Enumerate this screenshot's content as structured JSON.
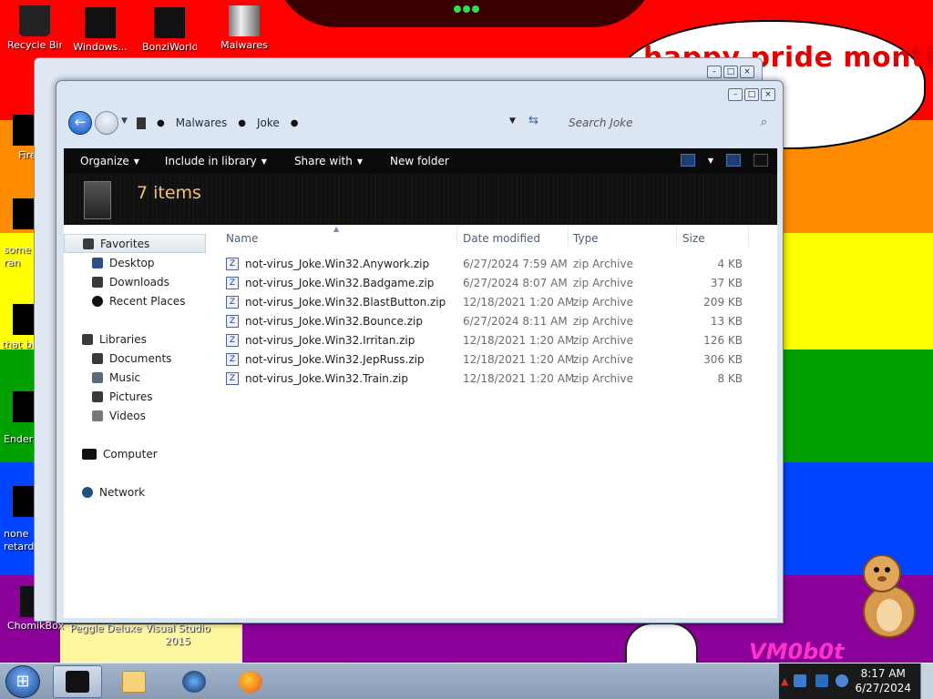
{
  "desktop": {
    "bubble_text": "happy pride month",
    "vm_tag": "VM0b0t",
    "icons": [
      {
        "label": "Recycle Bin"
      },
      {
        "label": "Windows..."
      },
      {
        "label": "BonziWorld"
      },
      {
        "label": "Malwares"
      },
      {
        "label": "Firefox"
      },
      {
        "label": "some ran"
      },
      {
        "label": "that bu"
      },
      {
        "label": "Ender"
      },
      {
        "label": "none retard"
      },
      {
        "label": "ChomikBox"
      },
      {
        "label": "Peggle Deluxe"
      },
      {
        "label": "Visual Studio 2015"
      }
    ]
  },
  "window": {
    "controls": {
      "minimize": "–",
      "maximize": "□",
      "close": "×"
    },
    "breadcrumb": [
      "Malwares",
      "Joke"
    ],
    "search_placeholder": "Search Joke",
    "toolbar": {
      "organize": "Organize",
      "include": "Include in library",
      "share": "Share with",
      "new_folder": "New folder"
    },
    "item_count": "7 items",
    "nav": {
      "favorites": "Favorites",
      "desktop": "Desktop",
      "downloads": "Downloads",
      "recent": "Recent Places",
      "libraries": "Libraries",
      "documents": "Documents",
      "music": "Music",
      "pictures": "Pictures",
      "videos": "Videos",
      "computer": "Computer",
      "network": "Network"
    },
    "columns": {
      "name": "Name",
      "date": "Date modified",
      "type": "Type",
      "size": "Size"
    },
    "files": [
      {
        "name": "not-virus_Joke.Win32.Anywork.zip",
        "date": "6/27/2024 7:59 AM",
        "type": "zip Archive",
        "size": "4 KB"
      },
      {
        "name": "not-virus_Joke.Win32.Badgame.zip",
        "date": "6/27/2024 8:07 AM",
        "type": "zip Archive",
        "size": "37 KB"
      },
      {
        "name": "not-virus_Joke.Win32.BlastButton.zip",
        "date": "12/18/2021 1:20 AM",
        "type": "zip Archive",
        "size": "209 KB"
      },
      {
        "name": "not-virus_Joke.Win32.Bounce.zip",
        "date": "6/27/2024 8:11 AM",
        "type": "zip Archive",
        "size": "13 KB"
      },
      {
        "name": "not-virus_Joke.Win32.Irritan.zip",
        "date": "12/18/2021 1:20 AM",
        "type": "zip Archive",
        "size": "126 KB"
      },
      {
        "name": "not-virus_Joke.Win32.JepRuss.zip",
        "date": "12/18/2021 1:20 AM",
        "type": "zip Archive",
        "size": "306 KB"
      },
      {
        "name": "not-virus_Joke.Win32.Train.zip",
        "date": "12/18/2021 1:20 AM",
        "type": "zip Archive",
        "size": "8 KB"
      }
    ]
  },
  "taskbar": {
    "time": "8:17 AM",
    "date": "6/27/2024"
  }
}
